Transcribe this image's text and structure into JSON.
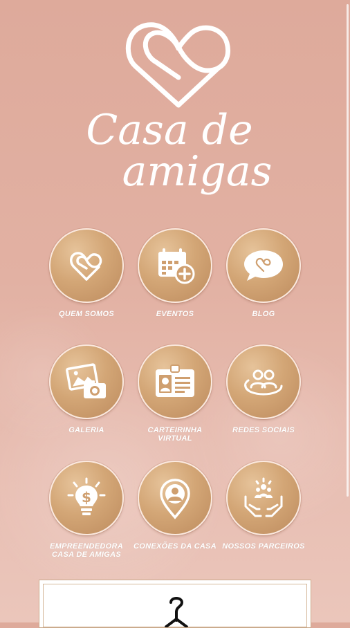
{
  "brand": {
    "line1": "Casa de",
    "line2": "amigas"
  },
  "menu": [
    {
      "label": "QUEM SOMOS",
      "icon": "heart-infinity-icon"
    },
    {
      "label": "EVENTOS",
      "icon": "calendar-add-icon"
    },
    {
      "label": "BLOG",
      "icon": "speech-bubble-icon"
    },
    {
      "label": "GALERIA",
      "icon": "photo-camera-icon"
    },
    {
      "label": "CARTEIRINHA VIRTUAL",
      "icon": "id-card-icon"
    },
    {
      "label": "REDES SOCIAIS",
      "icon": "people-network-icon"
    },
    {
      "label": "EMPREENDEDORA CASA DE AMIGAS",
      "icon": "lightbulb-dollar-icon"
    },
    {
      "label": "CONEXÕES DA CASA",
      "icon": "location-person-icon"
    },
    {
      "label": "NOSSOS PARCEIROS",
      "icon": "hands-partners-icon"
    }
  ],
  "colors": {
    "background": "#e2b1a3",
    "gold": "#d3a676",
    "white": "#ffffff"
  }
}
